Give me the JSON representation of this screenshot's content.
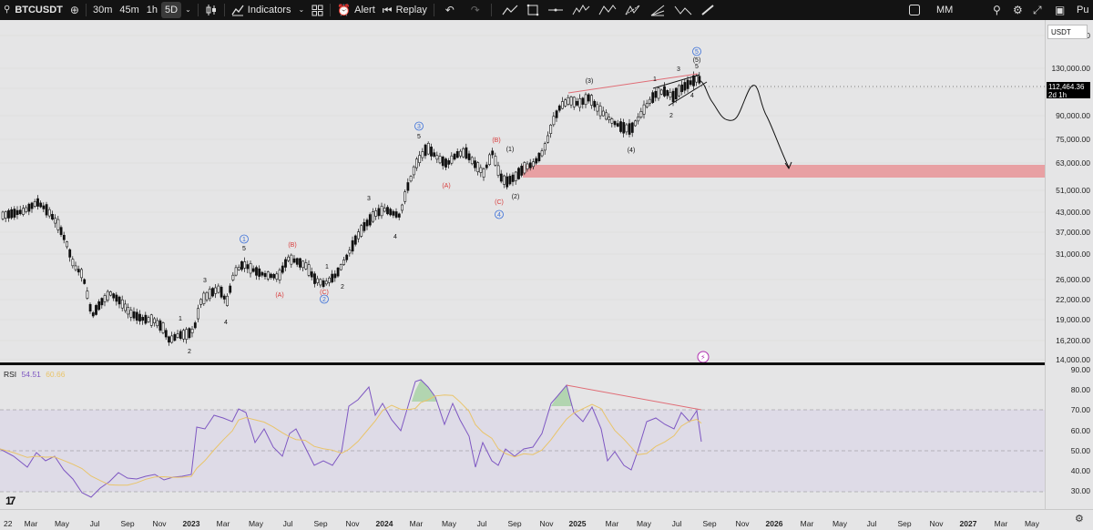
{
  "toolbar": {
    "symbol": "BTCUSDT",
    "add_symbol_icon": "plus-circle-icon",
    "intervals": [
      "30m",
      "45m",
      "1h",
      "5D"
    ],
    "active_interval": "5D",
    "indicators_label": "Indicators",
    "alert_label": "Alert",
    "replay_label": "Replay",
    "layout_name": "MM",
    "publish_label": "Pu"
  },
  "price_axis": {
    "currency": "USDT",
    "ticks": [
      "150,000.00",
      "130,000.00",
      "110,000.00",
      "90,000.00",
      "75,000.00",
      "63,000.00",
      "51,000.00",
      "43,000.00",
      "37,000.00",
      "31,000.00",
      "26,000.00",
      "22,000.00",
      "19,000.00",
      "16,200.00",
      "14,000.00"
    ],
    "last_price": "112,464.36",
    "countdown": "2d 1h"
  },
  "rsi": {
    "label": "RSI",
    "value": "54.51",
    "ma_value": "60.66",
    "ticks": [
      "90.00",
      "80.00",
      "70.00",
      "60.00",
      "50.00",
      "40.00",
      "30.00"
    ]
  },
  "time_axis": {
    "ticks": [
      "22",
      "Mar",
      "May",
      "Jul",
      "Sep",
      "Nov",
      "2023",
      "Mar",
      "May",
      "Jul",
      "Sep",
      "Nov",
      "2024",
      "Mar",
      "May",
      "Jul",
      "Sep",
      "Nov",
      "2025",
      "Mar",
      "May",
      "Jul",
      "Sep",
      "Nov",
      "2026",
      "Mar",
      "May",
      "Jul",
      "Sep",
      "Nov",
      "2027",
      "Mar",
      "May"
    ],
    "year_ticks": [
      "2023",
      "2024",
      "2025",
      "2026",
      "2027"
    ]
  },
  "wave_labels": {
    "blue_circles": [
      "1",
      "2",
      "3",
      "4",
      "5"
    ],
    "primary": [
      "(1)",
      "(2)",
      "(3)",
      "(4)",
      "(5)"
    ],
    "abc_red": [
      "(A)",
      "(B)",
      "(C)"
    ],
    "minor": [
      "1",
      "2",
      "3",
      "4",
      "5"
    ]
  },
  "colors": {
    "bg": "#e5e5e6",
    "toolbar_bg": "#131313",
    "candle": "#111111",
    "target_zone": "#e8a0a3",
    "divergence_line": "#e06c75",
    "rsi_line": "#7e57c2",
    "rsi_ma": "#e9c46a",
    "rsi_band": "#d9d3e8",
    "blue_label": "#3a6fd8",
    "red_label": "#d83a3a"
  },
  "icons": [
    "candles-icon",
    "indicators-icon",
    "templates-icon",
    "alert-icon",
    "replay-icon",
    "undo-icon",
    "redo-icon",
    "drawing-tools-icon",
    "fullscreen-icon",
    "settings-icon",
    "camera-icon",
    "search-icon",
    "lightning-icon"
  ]
}
